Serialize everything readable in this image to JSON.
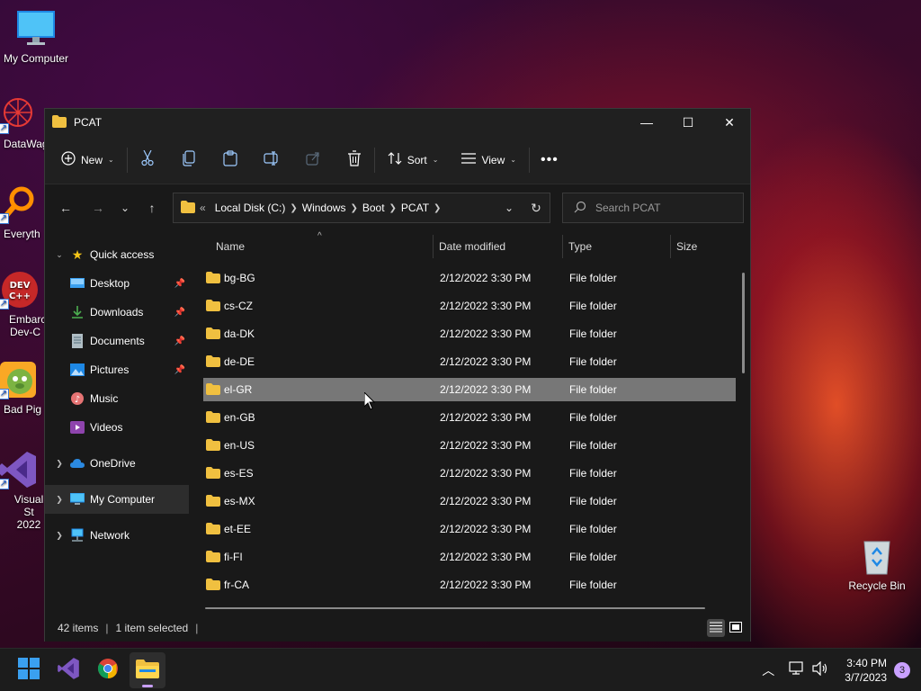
{
  "desktop": {
    "icons": [
      {
        "label": "My Computer"
      },
      {
        "label": "DataWag"
      },
      {
        "label": "Everyth"
      },
      {
        "label": "Embarca Dev-C"
      },
      {
        "label": "Bad Pig"
      },
      {
        "label": "Visual St 2022"
      },
      {
        "label": "Recycle Bin"
      }
    ]
  },
  "window": {
    "title": "PCAT",
    "toolbar": {
      "new_label": "New",
      "sort_label": "Sort",
      "view_label": "View"
    },
    "breadcrumb": [
      "Local Disk (C:)",
      "Windows",
      "Boot",
      "PCAT"
    ],
    "breadcrumb_overflow": "«",
    "search_placeholder": "Search PCAT",
    "nav": {
      "quick_access": "Quick access",
      "items": [
        {
          "label": "Desktop"
        },
        {
          "label": "Downloads"
        },
        {
          "label": "Documents"
        },
        {
          "label": "Pictures"
        },
        {
          "label": "Music"
        },
        {
          "label": "Videos"
        }
      ],
      "onedrive": "OneDrive",
      "my_computer": "My Computer",
      "network": "Network"
    },
    "columns": {
      "name": "Name",
      "date": "Date modified",
      "type": "Type",
      "size": "Size"
    },
    "files": [
      {
        "name": "bg-BG",
        "date": "2/12/2022 3:30 PM",
        "type": "File folder"
      },
      {
        "name": "cs-CZ",
        "date": "2/12/2022 3:30 PM",
        "type": "File folder"
      },
      {
        "name": "da-DK",
        "date": "2/12/2022 3:30 PM",
        "type": "File folder"
      },
      {
        "name": "de-DE",
        "date": "2/12/2022 3:30 PM",
        "type": "File folder"
      },
      {
        "name": "el-GR",
        "date": "2/12/2022 3:30 PM",
        "type": "File folder",
        "selected": true
      },
      {
        "name": "en-GB",
        "date": "2/12/2022 3:30 PM",
        "type": "File folder"
      },
      {
        "name": "en-US",
        "date": "2/12/2022 3:30 PM",
        "type": "File folder"
      },
      {
        "name": "es-ES",
        "date": "2/12/2022 3:30 PM",
        "type": "File folder"
      },
      {
        "name": "es-MX",
        "date": "2/12/2022 3:30 PM",
        "type": "File folder"
      },
      {
        "name": "et-EE",
        "date": "2/12/2022 3:30 PM",
        "type": "File folder"
      },
      {
        "name": "fi-FI",
        "date": "2/12/2022 3:30 PM",
        "type": "File folder"
      },
      {
        "name": "fr-CA",
        "date": "2/12/2022 3:30 PM",
        "type": "File folder"
      }
    ],
    "status": {
      "item_count": "42 items",
      "selection": "1 item selected"
    }
  },
  "taskbar": {
    "time": "3:40 PM",
    "date": "3/7/2023",
    "notification_count": "3"
  },
  "colors": {
    "selection": "#777777",
    "window_bg": "#191919",
    "accent": "#c9a0ff",
    "folder": "#f0c040"
  }
}
